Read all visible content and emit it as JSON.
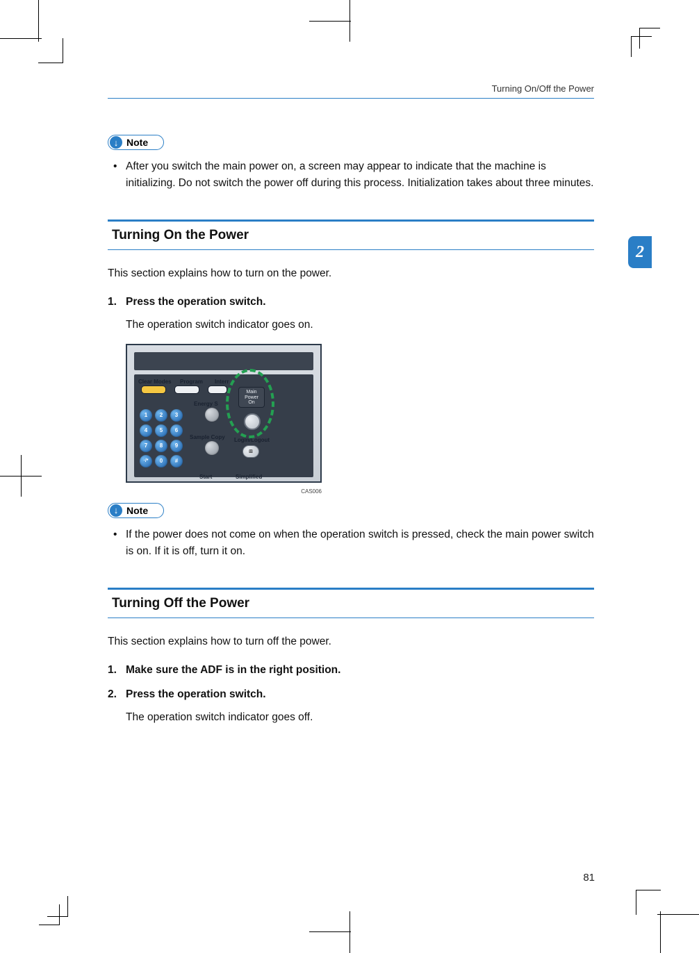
{
  "running_head": "Turning On/Off the Power",
  "chapter_tab": "2",
  "note_label": "Note",
  "note_icon": "↓",
  "note1_items": [
    "After you switch the main power on, a screen may appear to indicate that the machine is initializing. Do not switch the power off during this process. Initialization takes about three minutes."
  ],
  "section1": {
    "title": "Turning On the Power",
    "intro": "This section explains how to turn on the power.",
    "steps": [
      {
        "num": "1.",
        "text": "Press the operation switch.",
        "sub": "The operation switch indicator goes on."
      }
    ]
  },
  "figure": {
    "labels": {
      "clear_modes": "Clear Modes",
      "program": "Program",
      "interrupt": "Interr",
      "energy": "Energy S",
      "sample_copy": "Sample Copy",
      "start": "Start",
      "login_logout": "Login/Logout",
      "simplified": "Simplified",
      "main_power": "Main Power",
      "on": "On"
    },
    "keys": {
      "1": "1",
      "2": "2",
      "3": "3",
      "4": "4",
      "5": "5",
      "6": "6",
      "7": "7",
      "8": "8",
      "9": "9",
      "0": "0",
      "star": "·/*",
      "hash": "#"
    },
    "code": "CAS006"
  },
  "note2_items": [
    "If the power does not come on when the operation switch is pressed, check the main power switch is on. If it is off, turn it on."
  ],
  "section2": {
    "title": "Turning Off the Power",
    "intro": "This section explains how to turn off the power.",
    "steps": [
      {
        "num": "1.",
        "text": "Make sure the ADF is in the right position."
      },
      {
        "num": "2.",
        "text": "Press the operation switch.",
        "sub": "The operation switch indicator goes off."
      }
    ]
  },
  "page_number": "81"
}
